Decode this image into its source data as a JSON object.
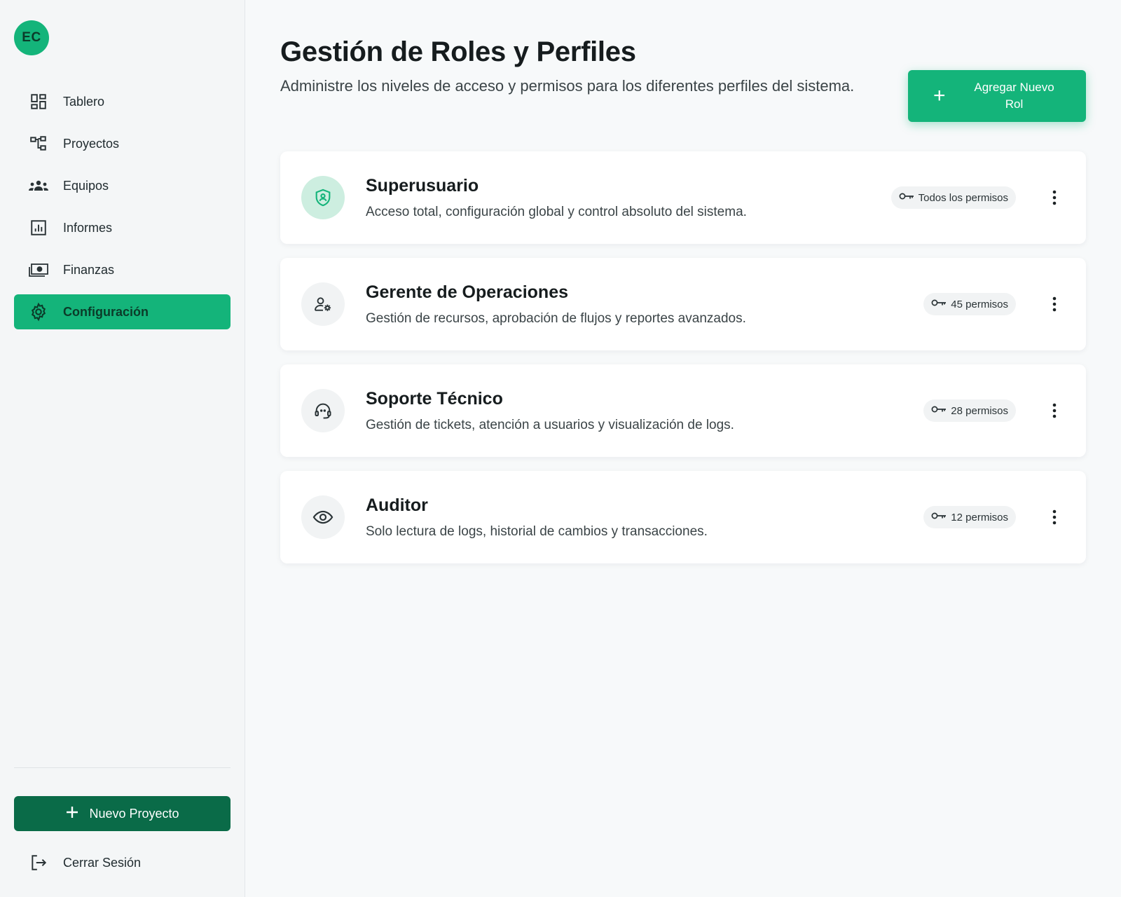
{
  "profile": {
    "initials": "EC",
    "name": "",
    "role": ""
  },
  "sidebar": {
    "items": [
      {
        "label": "Tablero",
        "icon": "dashboard-icon"
      },
      {
        "label": "Proyectos",
        "icon": "project-tree-icon"
      },
      {
        "label": "Equipos",
        "icon": "groups-icon"
      },
      {
        "label": "Informes",
        "icon": "bar-chart-icon"
      },
      {
        "label": "Finanzas",
        "icon": "money-icon"
      },
      {
        "label": "Configuración",
        "icon": "gear-icon",
        "active": true
      }
    ],
    "new_project_label": "Nuevo Proyecto",
    "logout_label": "Cerrar Sesión"
  },
  "header": {
    "title": "Gestión de Roles y Perfiles",
    "subtitle": "Administre los niveles de acceso y permisos para los diferentes perfiles del sistema.",
    "add_role_label": "Agregar Nuevo Rol",
    "add_role_icon": "+"
  },
  "roles": [
    {
      "name": "Superusuario",
      "description": "Acceso total, configuración global y control absoluto del sistema.",
      "permissions": "Todos los permisos",
      "icon": "shield-user-icon"
    },
    {
      "name": "Gerente de Operaciones",
      "description": "Gestión de recursos, aprobación de flujos y reportes avanzados.",
      "permissions": "45 permisos",
      "icon": "user-gear-icon"
    },
    {
      "name": "Soporte Técnico",
      "description": "Gestión de tickets, atención a usuarios y visualización de logs.",
      "permissions": "28 permisos",
      "icon": "support-agent-icon"
    },
    {
      "name": "Auditor",
      "description": "Solo lectura de logs, historial de cambios y transacciones.",
      "permissions": "12 permisos",
      "icon": "eye-icon"
    }
  ],
  "colors": {
    "accent": "#14b47a",
    "accent_dark": "#0a6b48",
    "sidebar_bg": "#f4f6f7",
    "page_bg": "#f7f9fa"
  }
}
